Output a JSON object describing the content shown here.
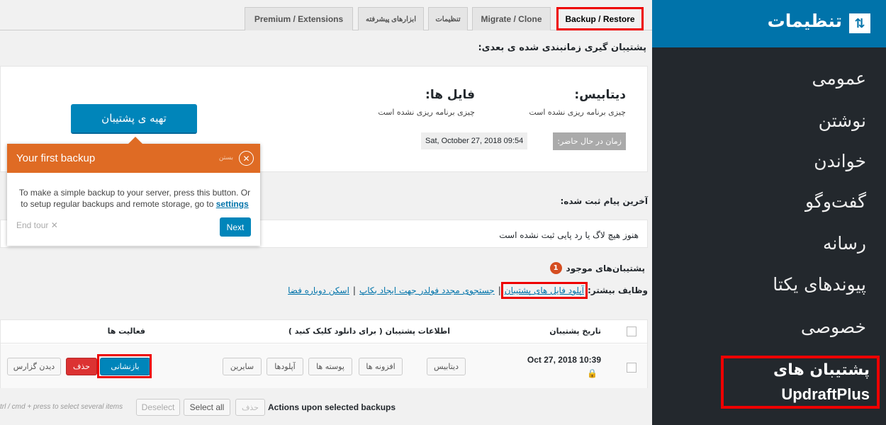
{
  "tabs": [
    "Backup / Restore",
    "Migrate / Clone",
    "تنظیمات",
    "ابزارهای پیشرفته",
    "Premium / Extensions"
  ],
  "next_backup_heading": "پشتیبان گیری زمانبندی شده ی بعدی:",
  "database": {
    "title": "دیتابیس:",
    "status": "چیزی برنامه ریزی نشده است"
  },
  "files": {
    "title": "فایل ها:",
    "status": "چیزی برنامه ریزی نشده است"
  },
  "current_time_label": "زمان در حال حاضر:",
  "current_time": "Sat, October 27, 2018 09:54",
  "backup_now": "تهیه ی پشتیبان",
  "tour": {
    "title": "Your first backup",
    "close": "بستن",
    "body": "To make a simple backup to your server, press this button. Or to setup regular backups and remote storage, go to ",
    "link": "settings",
    "end_tour": "End tour ✕",
    "next": "Next"
  },
  "last_log_heading": "آخرین پیام ثبت شده:",
  "last_log": "هنوز هیچ لاگ یا رد پایی ثبت نشده است",
  "existing_heading": "پشتیبان‌های موجود",
  "existing_count": "1",
  "more_tasks_label": "وظایف بیشتر:",
  "more_tasks": [
    "آپلود فایل های پشتیبان",
    "جستجوی مجدد فولدر جهت ایجاد بکاپ",
    "اسکن دوباره فضا"
  ],
  "table": {
    "headers": [
      "تاریخ پشتیبان",
      "اطلاعات پشتیبان ( برای دانلود کلیک کنید )",
      "فعالیت ها"
    ],
    "row": {
      "date": "Oct 27, 2018 10:39",
      "components": [
        "دیتابیس",
        "افزونه ها",
        "پوسته ها",
        "آپلودها",
        "سایرین"
      ],
      "actions": [
        "بازنشانی",
        "حذف",
        "دیدن گزارس"
      ]
    }
  },
  "bulk": {
    "label": "Actions upon selected backups",
    "delete": "حذف",
    "select_all": "Select all",
    "deselect": "Deselect",
    "hint": "trl / cmd + press to select several items"
  },
  "sidebar": {
    "title": "تنظیمات",
    "items": [
      "عمومی",
      "نوشتن",
      "خواندن",
      "گفت‌وگو",
      "رسانه",
      "پیوندهای یکتا",
      "خصوصی"
    ],
    "updraft_line1": "پشتیبان های",
    "updraft_line2": "UpdraftPlus"
  },
  "colors": {
    "primary": "#0085ba",
    "tour": "#df6b24",
    "delete": "#dc3232",
    "highlight": "#e00000",
    "sidebar": "#23282d",
    "sidebar_header": "#0073aa"
  }
}
